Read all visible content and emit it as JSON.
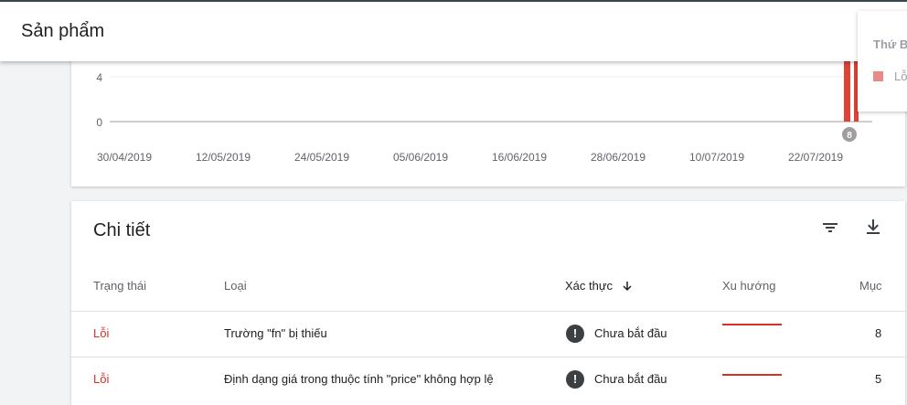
{
  "header": {
    "title": "Sản phẩm"
  },
  "chart_data": {
    "type": "bar",
    "yticks": [
      "4",
      "0"
    ],
    "xticks": [
      "30/04/2019",
      "12/05/2019",
      "24/05/2019",
      "05/06/2019",
      "16/06/2019",
      "28/06/2019",
      "10/07/2019",
      "22/07/2019"
    ],
    "marker_label": "8",
    "bar_color": "#db4437"
  },
  "legend_popup": {
    "title": "Thứ B",
    "item_label": "Lỗ"
  },
  "detail": {
    "title": "Chi tiết",
    "columns": {
      "status": "Trạng thái",
      "type": "Loại",
      "validation": "Xác thực",
      "trend": "Xu hướng",
      "items": "Mục"
    },
    "rows": [
      {
        "status": "Lỗi",
        "type": "Trường \"fn\" bị thiếu",
        "validation": "Chưa bắt đầu",
        "items": "8"
      },
      {
        "status": "Lỗi",
        "type": "Định dạng giá trong thuộc tính \"price\" không hợp lệ",
        "validation": "Chưa bắt đầu",
        "items": "5"
      }
    ]
  },
  "icons": {
    "filter": "filter-icon",
    "download": "download-icon",
    "sort": "arrow-down-icon",
    "alert": "exclamation-icon"
  }
}
